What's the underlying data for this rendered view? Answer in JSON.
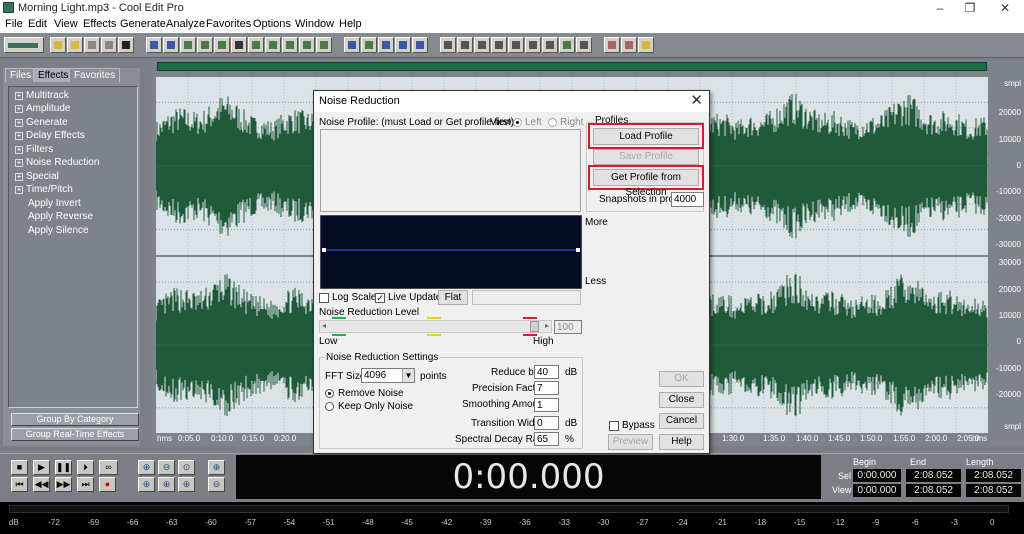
{
  "window": {
    "title": "Morning Light.mp3 - Cool Edit Pro",
    "controls": [
      "–",
      "❐",
      "✕"
    ]
  },
  "menu": [
    "File",
    "Edit",
    "View",
    "Effects",
    "Generate",
    "Analyze",
    "Favorites",
    "Options",
    "Window",
    "Help"
  ],
  "left_panel": {
    "tabs": [
      "Files",
      "Effects",
      "Favorites"
    ],
    "active_tab": "Effects",
    "tree": [
      {
        "label": "Multitrack",
        "expandable": true
      },
      {
        "label": "Amplitude",
        "expandable": true
      },
      {
        "label": "Generate",
        "expandable": true
      },
      {
        "label": "Delay Effects",
        "expandable": true
      },
      {
        "label": "Filters",
        "expandable": true
      },
      {
        "label": "Noise Reduction",
        "expandable": true
      },
      {
        "label": "Special",
        "expandable": true
      },
      {
        "label": "Time/Pitch",
        "expandable": true
      },
      {
        "label": "Apply Invert",
        "expandable": false
      },
      {
        "label": "Apply Reverse",
        "expandable": false
      },
      {
        "label": "Apply Silence",
        "expandable": false
      }
    ],
    "group_by_category": "Group By Category",
    "group_realtime": "Group Real-Time Effects"
  },
  "wave": {
    "scale_unit": "smpl",
    "top_channel_scale": [
      "20000",
      "10000",
      "0",
      "-10000",
      "-20000",
      "-30000"
    ],
    "bottom_channel_scale": [
      "30000",
      "20000",
      "10000",
      "0",
      "-10000",
      "-20000",
      "smpl"
    ],
    "timeline": [
      "hms",
      "0:05.0",
      "0:10.0",
      "0:15.0",
      "0:20.0",
      "1:30.0",
      "1:35.0",
      "1:40.0",
      "1:45.0",
      "1:50.0",
      "1:55.0",
      "2:00.0",
      "2:05.0",
      "hms"
    ],
    "wave_color": "#1f5a3a"
  },
  "transport": {
    "time": "0:00.000",
    "headers": [
      "Begin",
      "End",
      "Length"
    ],
    "sel_label": "Sel",
    "view_label": "View",
    "sel": [
      "0:00.000",
      "2:08.052",
      "2:08.052"
    ],
    "view": [
      "0:00.000",
      "2:08.052",
      "2:08.052"
    ]
  },
  "level_meter": [
    "dB",
    "-72",
    "-69",
    "-66",
    "-63",
    "-60",
    "-57",
    "-54",
    "-51",
    "-48",
    "-45",
    "-42",
    "-39",
    "-36",
    "-33",
    "-30",
    "-27",
    "-24",
    "-21",
    "-18",
    "-15",
    "-12",
    "-9",
    "-6",
    "-3",
    "0"
  ],
  "dialog": {
    "title": "Noise Reduction",
    "noise_profile_label": "Noise Profile: (must Load or Get profile first)",
    "view_label": "View:",
    "view_left": "Left",
    "view_right": "Right",
    "profiles_group": "Profiles",
    "load_profile": "Load Profile",
    "save_profile": "Save Profile",
    "get_profile": "Get Profile from Selection",
    "snapshots_label": "Snapshots in profile",
    "snapshots_value": "4000",
    "more_label": "More",
    "less_label": "Less",
    "log_scale": "Log Scale",
    "live_update": "Live Update",
    "flat": "Flat",
    "nr_level_label": "Noise Reduction Level",
    "nr_level_value": "100",
    "low": "Low",
    "high": "High",
    "settings_group": "Noise Reduction Settings",
    "fft_label": "FFT Size",
    "fft_value": "4096",
    "fft_unit": "points",
    "remove_noise": "Remove Noise",
    "keep_only_noise": "Keep Only Noise",
    "reduce_by_label": "Reduce by",
    "reduce_by_value": "40",
    "reduce_by_unit": "dB",
    "precision_label": "Precision Factor",
    "precision_value": "7",
    "smoothing_label": "Smoothing Amount",
    "smoothing_value": "1",
    "transition_label": "Transition Width",
    "transition_value": "0",
    "transition_unit": "dB",
    "decay_label": "Spectral Decay Rate",
    "decay_value": "65",
    "decay_unit": "%",
    "ok": "OK",
    "close": "Close",
    "cancel": "Cancel",
    "help": "Help",
    "bypass": "Bypass",
    "preview": "Preview",
    "highlight_color": "#d21f2b"
  }
}
